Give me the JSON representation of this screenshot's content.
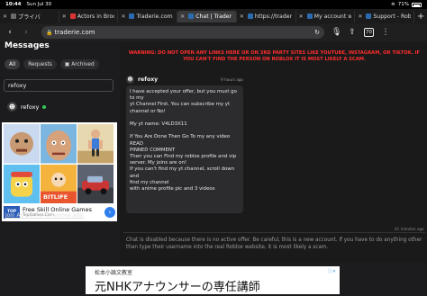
{
  "status_bar": {
    "time": "10:44",
    "date": "Sun Jul 30",
    "battery": "71%"
  },
  "tabs": [
    {
      "label": "プライバ",
      "favicon_color": "#6b6b6b",
      "active": false
    },
    {
      "label": "Actors in Broo",
      "favicon_color": "#d33",
      "active": false
    },
    {
      "label": "Traderie.com",
      "favicon_color": "#2b6cb0",
      "active": false
    },
    {
      "label": "Chat | Trader",
      "favicon_color": "#2b6cb0",
      "active": true
    },
    {
      "label": "https://trader",
      "favicon_color": "#2b6cb0",
      "active": false
    },
    {
      "label": "My account w",
      "favicon_color": "#2b6cb0",
      "active": false
    },
    {
      "label": "Support - Robl",
      "favicon_color": "#2b6cb0",
      "active": false
    }
  ],
  "url_bar": {
    "text": "traderie.com",
    "tab_count": "70"
  },
  "sidebar": {
    "title": "Messages",
    "filters": [
      {
        "label": "All",
        "active": true
      },
      {
        "label": "Requests",
        "active": false
      },
      {
        "label": "Archived",
        "active": false
      }
    ],
    "search_value": "refoxy",
    "user": {
      "name": "refoxy"
    },
    "ad": {
      "title": "Free Skill Online Games",
      "source": "TopGames.Com",
      "logo_line1": "TOP",
      "logo_line2": "GAMES",
      "tiles": [
        "",
        "",
        "",
        "",
        "BITLIFE",
        ""
      ]
    },
    "remove_ads_link": "Join Akrew Pro to remove ads!"
  },
  "main": {
    "warning": "WARNING: DO NOT OPEN ANY LINKS HERE OR ON 3RD PARTY SITES LIKE YOUTUBE, INSTAGRAM, OR TIKTOK. IF YOU CAN'T FIND THE PERSON ON ROBLOX IT IS MOST LIKELY A SCAM.",
    "message": {
      "user": "refoxy",
      "time": "9 hours ago",
      "text": "I have accepted your offer, but you must go to my\nyt Channel First. You can subscribe my yt\nchannel or No!\n\nMy yt name: V4LD3X11\n\nIf You Are Done Then Go To my any video READ\nPINNED COMMENT\nThen you can Find my roblox profile and vip\nserver. My joins are on!\nIf you can't find my yt channel, scroll down and\nfind my channel\nwith anime profile pic and 3 videos"
    },
    "last_time": "41 minutes ago",
    "disabled_note": "Chat is disabled because there is no active offer. Be careful, this is a new account. If you have to do anything other than type their username into the real Roblox website, it is most likely a scam."
  },
  "bottom_ad": {
    "small_text": "松本小論文教室",
    "big_text": "元NHKアナウンサーの専任講師"
  }
}
